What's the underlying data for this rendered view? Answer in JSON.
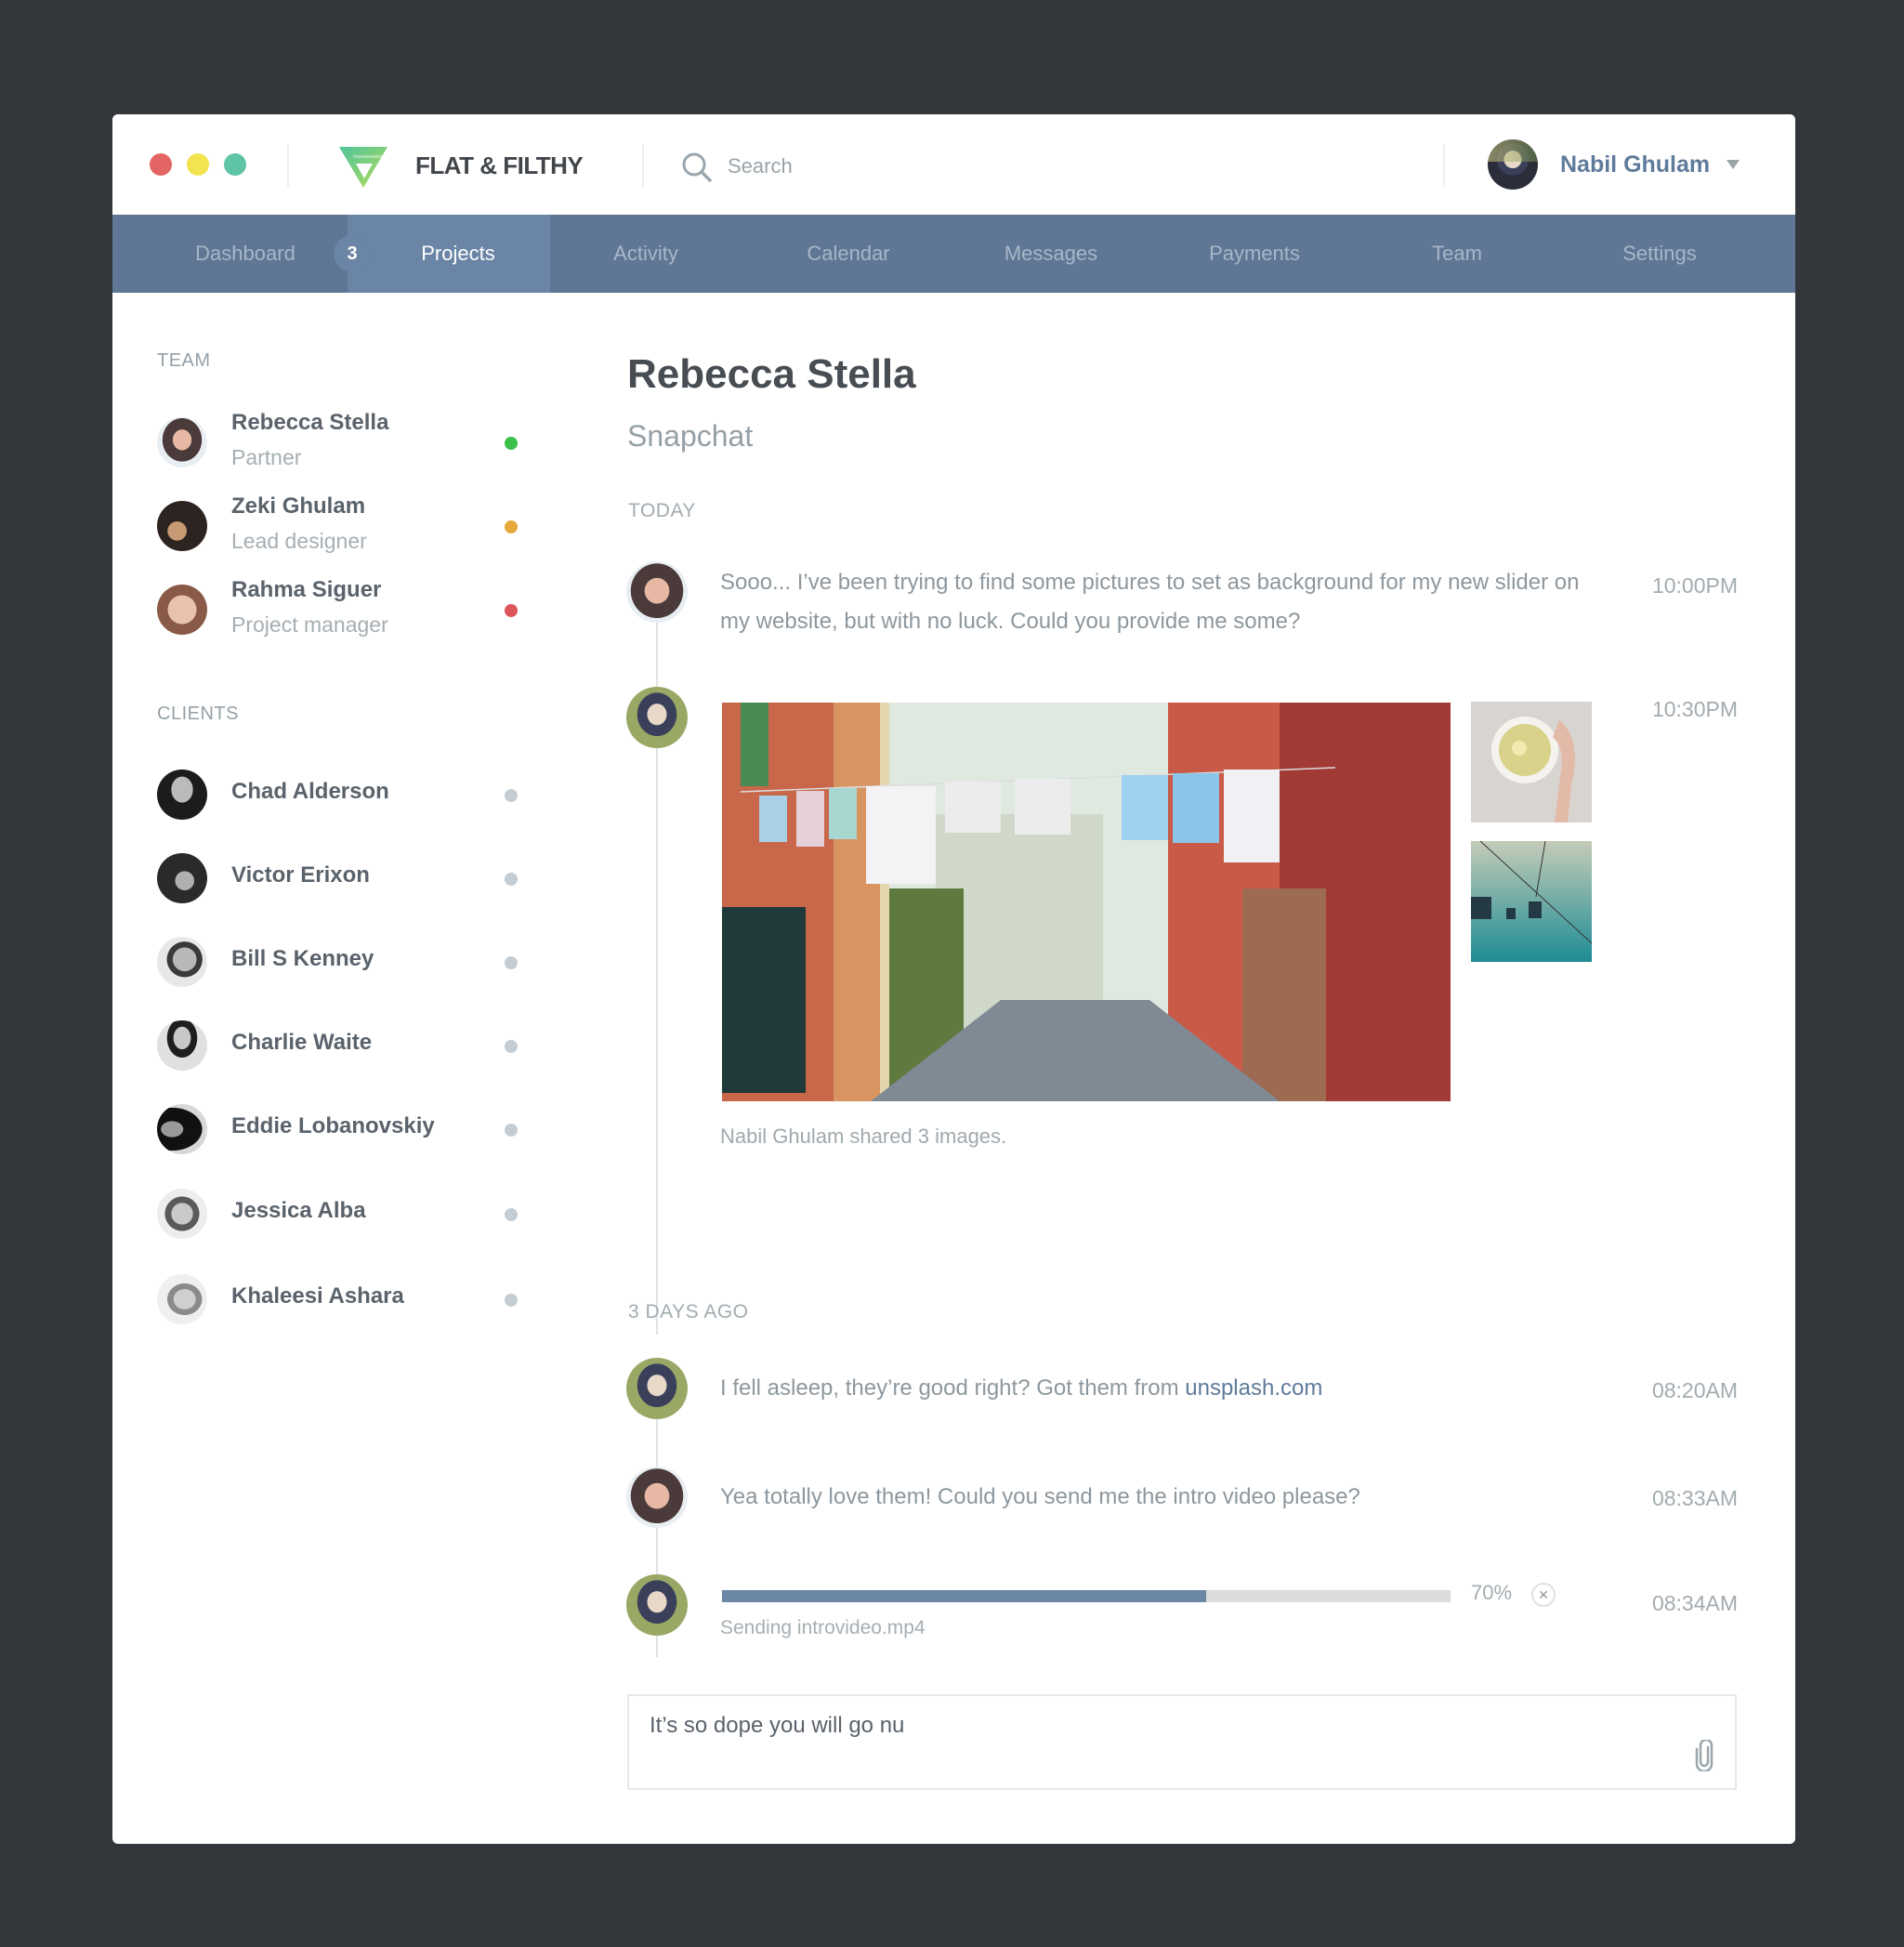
{
  "window": {
    "traffic_lights": [
      "close",
      "minimize",
      "maximize"
    ],
    "colors": {
      "close": "#e36563",
      "minimize": "#f2e34f",
      "maximize": "#5fc3a6"
    }
  },
  "header": {
    "brand": "FLAT & FILTHY",
    "logo_icon": "triangle-f-logo-icon",
    "search": {
      "placeholder": "Search",
      "value": "",
      "icon": "search-icon"
    },
    "user": {
      "name": "Nabil Ghulam",
      "menu_icon": "caret-down-icon"
    }
  },
  "nav": {
    "items": [
      {
        "label": "Dashboard",
        "active": false
      },
      {
        "label": "Projects",
        "active": true,
        "badge": "3"
      },
      {
        "label": "Activity",
        "active": false
      },
      {
        "label": "Calendar",
        "active": false
      },
      {
        "label": "Messages",
        "active": false
      },
      {
        "label": "Payments",
        "active": false
      },
      {
        "label": "Team",
        "active": false
      },
      {
        "label": "Settings",
        "active": false
      }
    ]
  },
  "sidebar": {
    "team_label": "TEAM",
    "team": [
      {
        "name": "Rebecca Stella",
        "role": "Partner",
        "status": "online",
        "status_color": "#3cc04a"
      },
      {
        "name": "Zeki Ghulam",
        "role": "Lead designer",
        "status": "away",
        "status_color": "#e5a83a"
      },
      {
        "name": "Rahma Siguer",
        "role": "Project manager",
        "status": "busy",
        "status_color": "#dc5659"
      }
    ],
    "clients_label": "CLIENTS",
    "clients": [
      {
        "name": "Chad Alderson",
        "status_color": "#c4cdd3"
      },
      {
        "name": "Victor Erixon",
        "status_color": "#c4cdd3"
      },
      {
        "name": "Bill S Kenney",
        "status_color": "#c4cdd3"
      },
      {
        "name": "Charlie Waite",
        "status_color": "#c4cdd3"
      },
      {
        "name": "Eddie Lobanovskiy",
        "status_color": "#c4cdd3"
      },
      {
        "name": "Jessica Alba",
        "status_color": "#c4cdd3"
      },
      {
        "name": "Khaleesi Ashara",
        "status_color": "#c4cdd3"
      }
    ]
  },
  "conversation": {
    "title": "Rebecca Stella",
    "subtitle": "Snapchat",
    "today_label": "TODAY",
    "today": [
      {
        "sender": "Rebecca Stella",
        "text": "Sooo... I’ve been trying to find some pictures to set as background for my new slider on my website, but with no luck. Could you provide me some?",
        "time": "10:00PM"
      },
      {
        "sender": "Nabil Ghulam",
        "type": "images",
        "images": [
          "venice-street-laundry",
          "tea-cup-lemon",
          "cable-cars"
        ],
        "caption": "Nabil Ghulam shared 3 images.",
        "time": "10:30PM"
      }
    ],
    "earlier_label": "3 DAYS AGO",
    "earlier": [
      {
        "sender": "Nabil Ghulam",
        "text": "I fell asleep, they’re good right? Got them from ",
        "link": "unsplash.com",
        "time": "08:20AM"
      },
      {
        "sender": "Rebecca Stella",
        "text": "Yea totally love them! Could you send me the intro video please?",
        "time": "08:33AM"
      },
      {
        "sender": "Nabil Ghulam",
        "type": "upload",
        "progress_percent": 70,
        "progress_label": "70%",
        "status": "Sending introvideo.mp4",
        "time": "08:34AM"
      }
    ]
  },
  "composer": {
    "value": "It’s so dope you will go nu",
    "attach_icon": "paperclip-icon"
  },
  "colors": {
    "nav_bg": "#5f7694",
    "nav_active_bg": "#6a85a5",
    "accent": "#5f7b9b",
    "progress_fill": "#6c86a6",
    "progress_track": "#dcdcdc"
  }
}
